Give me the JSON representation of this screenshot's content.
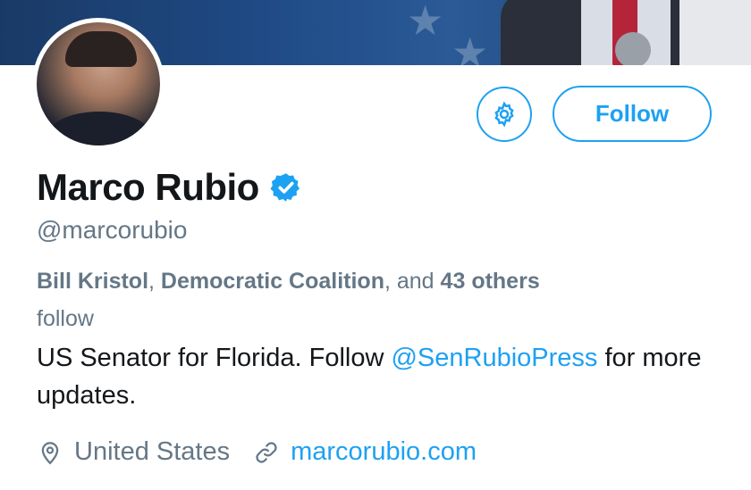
{
  "profile": {
    "name": "Marco Rubio",
    "handle": "@marcorubio",
    "follow_label": "Follow",
    "followed_by": {
      "name1": "Bill Kristol",
      "sep": ", ",
      "name2": "Democratic Coalition",
      "and_text": ", and ",
      "count": "43",
      "others": "others",
      "tail": " follow"
    },
    "bio": {
      "text_before": "US Senator for Florida. Follow ",
      "mention": "@SenRubioPress",
      "text_after": " for more updates."
    },
    "location": "United States",
    "website": "marcorubio.com"
  },
  "icons": {
    "settings": "gear-icon",
    "verified": "verified-badge-icon",
    "location": "location-pin-icon",
    "link": "link-icon"
  },
  "colors": {
    "accent": "#1da1f2",
    "secondary_text": "#657786",
    "primary_text": "#14171a"
  }
}
